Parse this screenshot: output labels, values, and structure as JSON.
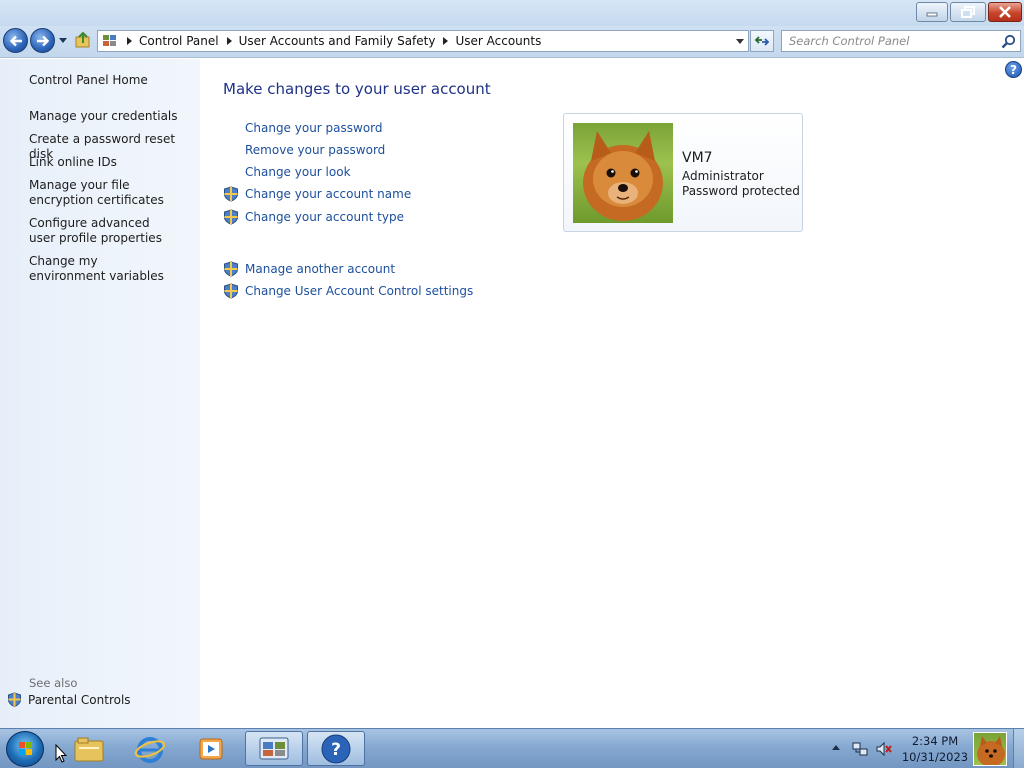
{
  "window": {
    "buttons": [
      "minimize",
      "maximize",
      "close"
    ]
  },
  "navigation": {
    "breadcrumbs": [
      "Control Panel",
      "User Accounts and Family Safety",
      "User Accounts"
    ],
    "search_placeholder": "Search Control Panel"
  },
  "sidebar": {
    "home": "Control Panel Home",
    "links": [
      "Manage your credentials",
      "Create a password reset disk",
      "Link online IDs",
      "Manage your file encryption certificates",
      "Configure advanced user profile properties",
      "Change my environment variables"
    ],
    "see_also_label": "See also",
    "see_also_links": [
      "Parental Controls"
    ]
  },
  "main": {
    "heading": "Make changes to your user account",
    "tasks": [
      {
        "label": "Change your password",
        "shield": false
      },
      {
        "label": "Remove your password",
        "shield": false
      },
      {
        "label": "Change your look",
        "shield": false
      },
      {
        "label": "Change your account name",
        "shield": true
      },
      {
        "label": "Change your account type",
        "shield": true
      }
    ],
    "other_tasks": [
      {
        "label": "Manage another account",
        "shield": true
      },
      {
        "label": "Change User Account Control settings",
        "shield": true
      }
    ],
    "account": {
      "name": "VM7",
      "role": "Administrator",
      "status": "Password protected"
    }
  },
  "taskbar": {
    "items": [
      "windows-explorer",
      "internet-explorer",
      "media-player",
      "control-panel",
      "help-and-support"
    ],
    "active_item": "control-panel",
    "clock_time": "2:34 PM",
    "clock_date": "10/31/2023"
  },
  "colors": {
    "link": "#1c4f9c",
    "heading": "#1e3287",
    "sidebar_bg": "#e9f1fa",
    "taskbar": "#86a9d1"
  }
}
